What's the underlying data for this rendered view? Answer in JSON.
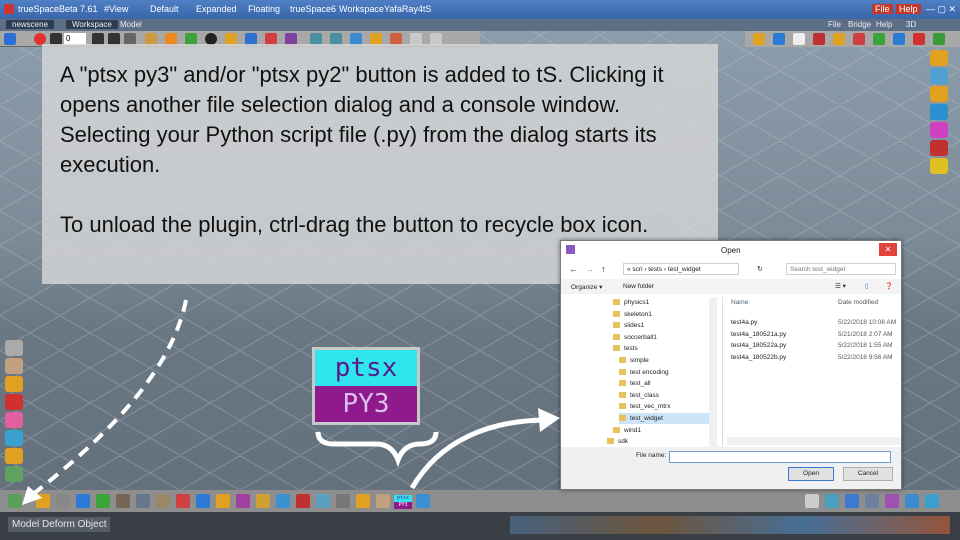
{
  "app": {
    "title": "trueSpaceBeta 7.61",
    "title_tabs": [
      "#View",
      "Default",
      "Expanded",
      "Floating",
      "trueSpace6",
      "Workspace",
      "YafaRay4tS"
    ],
    "right_menu": [
      "File",
      "Help"
    ]
  },
  "menubar": {
    "scene": "newscene",
    "tabs": [
      "Workspace",
      "Model"
    ],
    "right": [
      "File",
      "Bridge",
      "Help",
      "3D"
    ]
  },
  "toolbar": {
    "frame_value": "0"
  },
  "overlay": {
    "paragraph1": "A \"ptsx py3\" and/or \"ptsx py2\" button is added to tS. Clicking it opens another file selection dialog and a console window. Selecting your Python script file (.py) from the dialog starts its execution.",
    "paragraph2": "To unload the plugin, ctrl-drag the button to recycle box icon."
  },
  "ptsx_button": {
    "top": "ptsx",
    "bottom": "PY3"
  },
  "ptsx_small": {
    "top": "ptsx",
    "bottom": "PY3"
  },
  "status": {
    "label": "Model  Deform Object"
  },
  "dialog": {
    "title": "Open",
    "close": "✕",
    "breadcrumb": "« scri › tests › test_widget",
    "search_placeholder": "Search test_widget",
    "organize": "Organize ▾",
    "new_folder": "New folder",
    "columns": {
      "name": "Name",
      "date": "Date modified"
    },
    "folders": [
      {
        "label": "physics1",
        "indent": 1,
        "selected": false
      },
      {
        "label": "skeleton1",
        "indent": 1,
        "selected": false
      },
      {
        "label": "slides1",
        "indent": 1,
        "selected": false
      },
      {
        "label": "soccerball1",
        "indent": 1,
        "selected": false
      },
      {
        "label": "tests",
        "indent": 1,
        "selected": false
      },
      {
        "label": "simple",
        "indent": 2,
        "selected": false
      },
      {
        "label": "test encoding",
        "indent": 2,
        "selected": false
      },
      {
        "label": "test_all",
        "indent": 2,
        "selected": false
      },
      {
        "label": "test_class",
        "indent": 2,
        "selected": false
      },
      {
        "label": "test_vec_mtrx",
        "indent": 2,
        "selected": false
      },
      {
        "label": "test_widget",
        "indent": 2,
        "selected": true
      },
      {
        "label": "wind1",
        "indent": 1,
        "selected": false
      },
      {
        "label": "sdk",
        "indent": 0,
        "selected": false
      }
    ],
    "files": [
      {
        "name": "test4a.py",
        "date": "5/22/2018 10:08 AM"
      },
      {
        "name": "test4a_180521a.py",
        "date": "5/21/2018 2:07 AM"
      },
      {
        "name": "test4a_180522a.py",
        "date": "5/22/2018 1:55 AM"
      },
      {
        "name": "test4a_180522b.py",
        "date": "5/22/2018 9:56 AM"
      }
    ],
    "file_name_label": "File name:",
    "file_name_value": "",
    "open_button": "Open",
    "cancel_button": "Cancel"
  }
}
